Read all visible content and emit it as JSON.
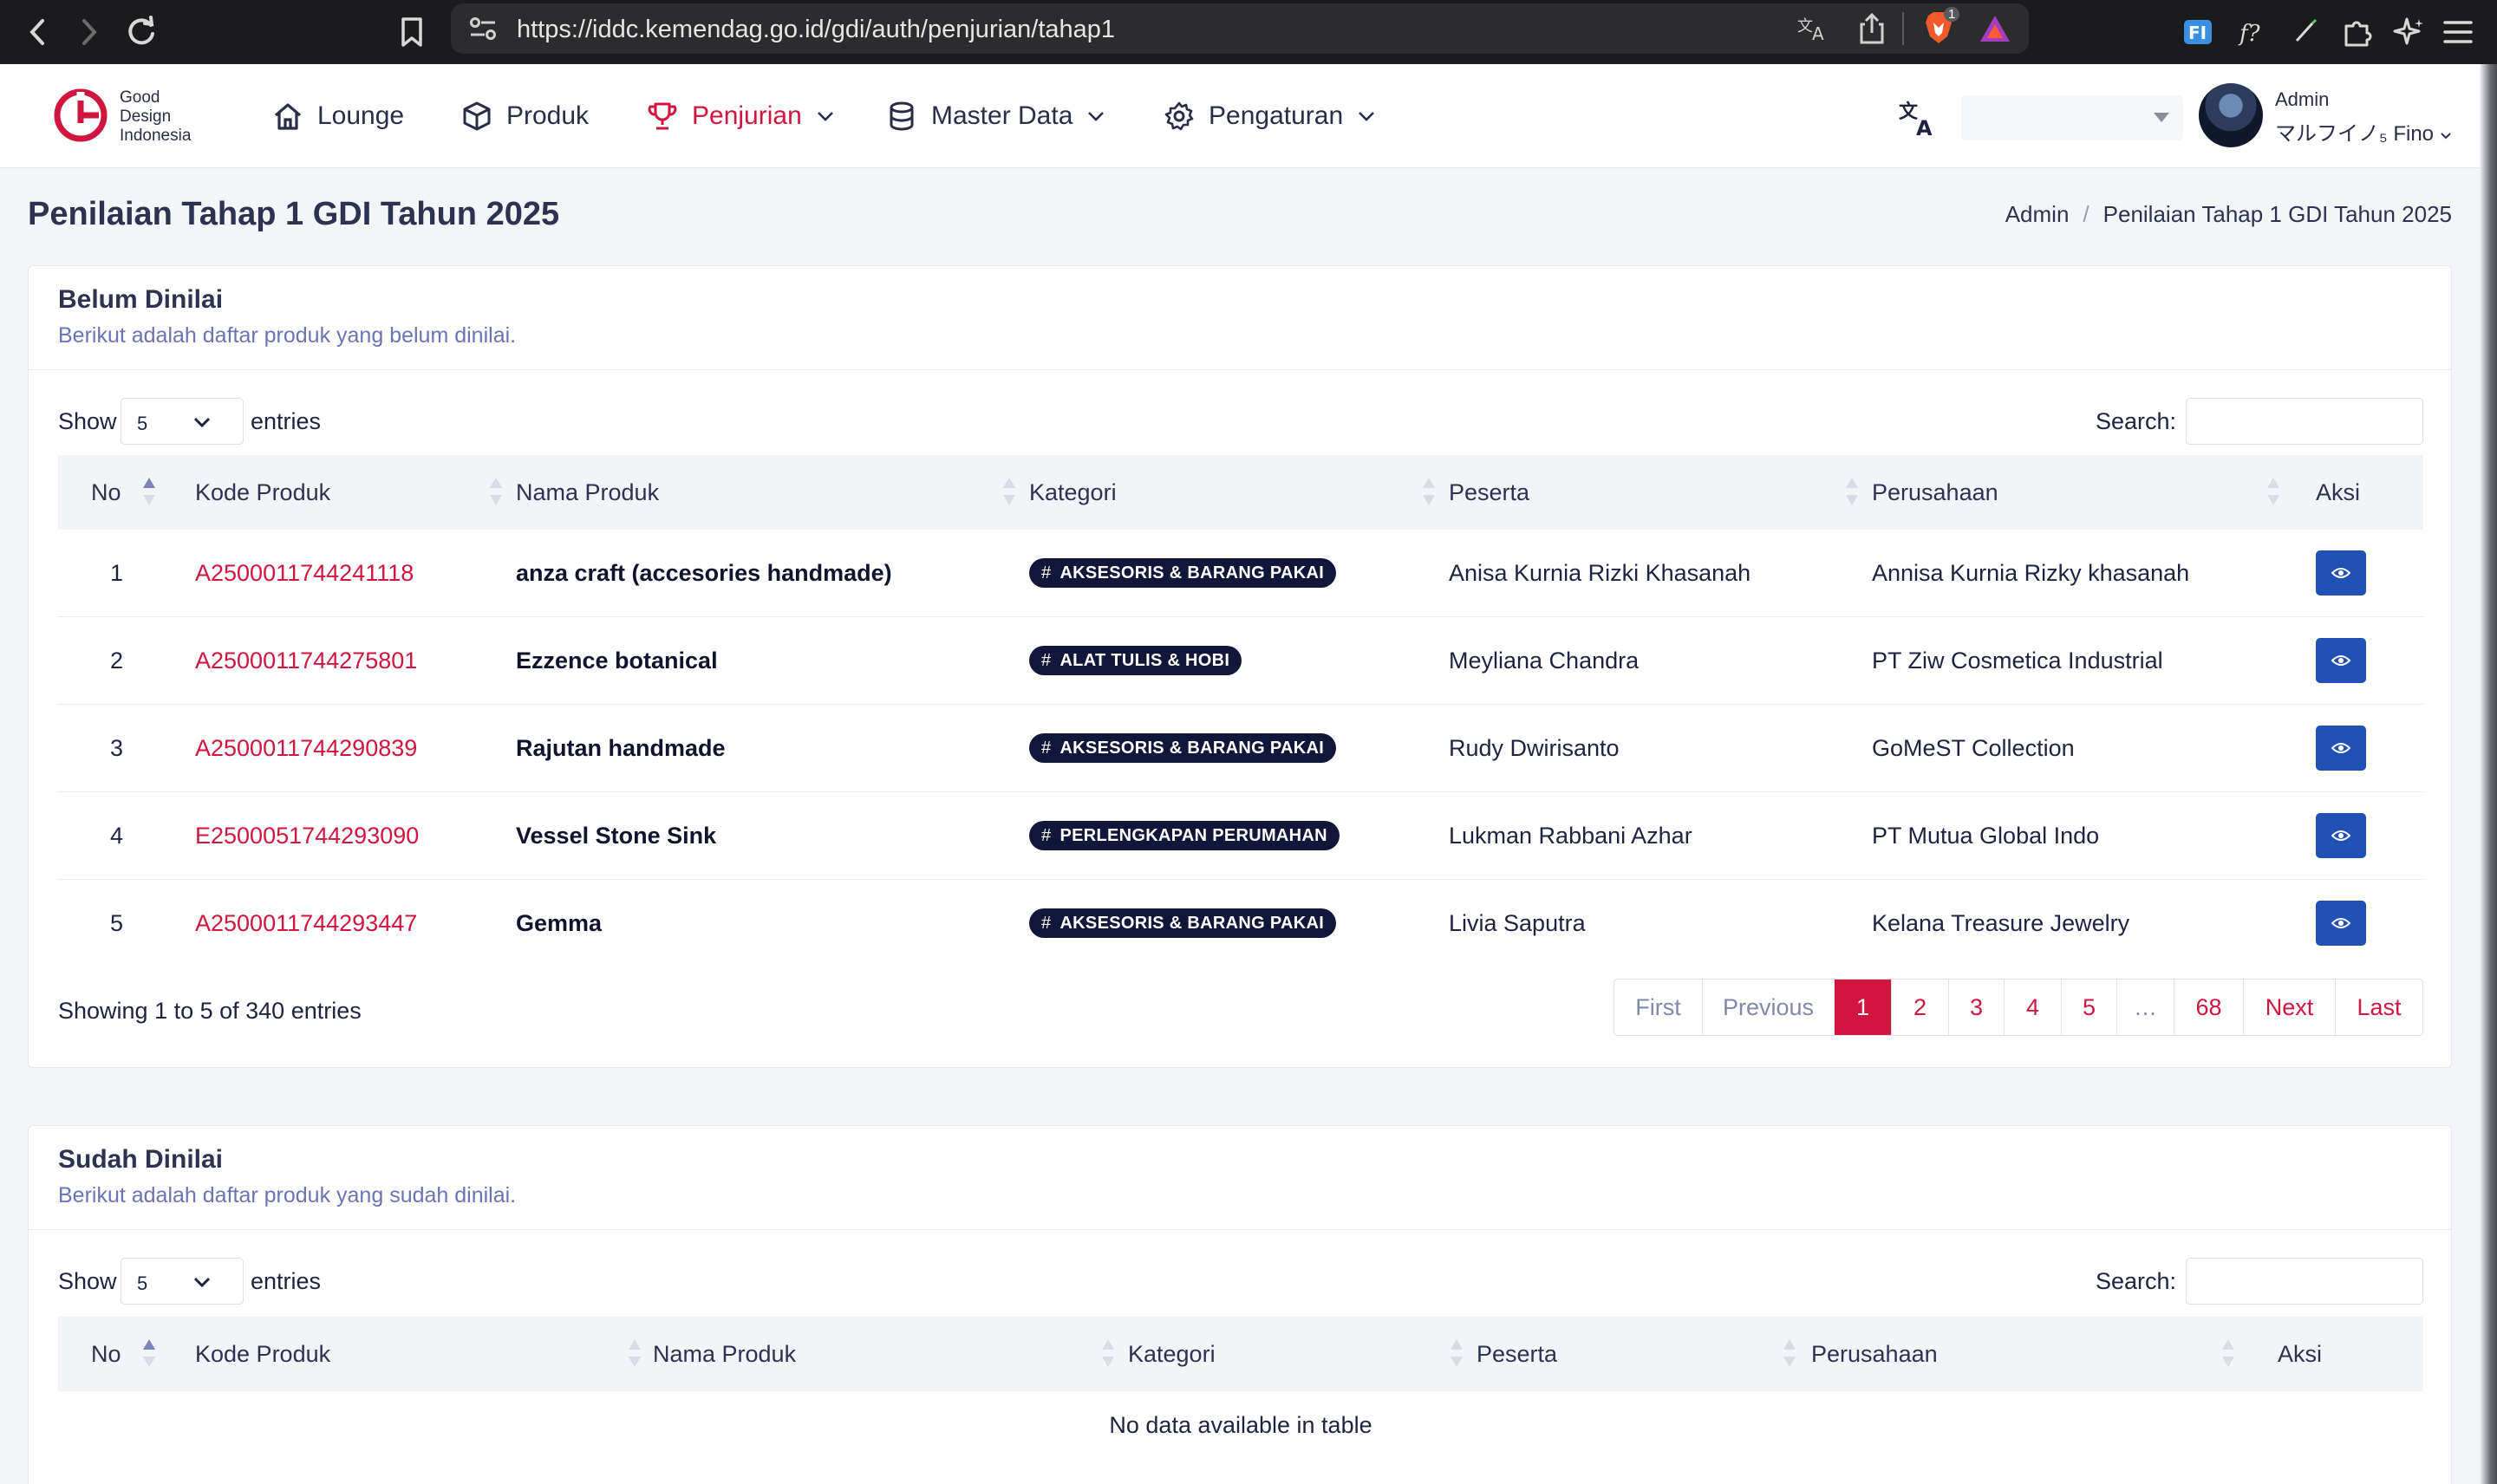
{
  "browser": {
    "url": "https://iddc.kemendag.go.id/gdi/auth/penjurian/tahap1",
    "shield_count": "1"
  },
  "app": {
    "logo": [
      "Good",
      "Design",
      "Indonesia"
    ],
    "menu": [
      {
        "label": "Lounge",
        "icon": "home-icon"
      },
      {
        "label": "Produk",
        "icon": "box-icon"
      },
      {
        "label": "Penjurian",
        "icon": "trophy-icon",
        "active": true
      },
      {
        "label": "Master Data",
        "icon": "database-icon"
      },
      {
        "label": "Pengaturan",
        "icon": "gear-icon"
      }
    ],
    "user": {
      "role": "Admin",
      "name": "マルフイノ₅ Fino"
    }
  },
  "page": {
    "title": "Penilaian Tahap 1 GDI Tahun 2025",
    "breadcrumb": [
      "Admin",
      "Penilaian Tahap 1 GDI Tahun 2025"
    ]
  },
  "colors": {
    "accent": "#d0153f",
    "action": "#2151b5",
    "badge": "#12163a"
  },
  "belum": {
    "title": "Belum Dinilai",
    "subtitle": "Berikut adalah daftar produk yang belum dinilai.",
    "show_label": "Show",
    "entries_value": "5",
    "entries_label": "entries",
    "search_label": "Search:",
    "columns": [
      "No",
      "Kode Produk",
      "Nama Produk",
      "Kategori",
      "Peserta",
      "Perusahaan",
      "Aksi"
    ],
    "rows": [
      {
        "no": "1",
        "code": "A2500011744241118",
        "name": "anza craft (accesories handmade)",
        "category": "AKSESORIS & BARANG PAKAI",
        "participant": "Anisa Kurnia Rizki Khasanah",
        "company": "Annisa Kurnia Rizky khasanah"
      },
      {
        "no": "2",
        "code": "A2500011744275801",
        "name": "Ezzence botanical",
        "category": "ALAT TULIS & HOBI",
        "participant": "Meyliana Chandra",
        "company": "PT Ziw Cosmetica Industrial"
      },
      {
        "no": "3",
        "code": "A2500011744290839",
        "name": "Rajutan handmade",
        "category": "AKSESORIS & BARANG PAKAI",
        "participant": "Rudy Dwirisanto",
        "company": "GoMeST Collection"
      },
      {
        "no": "4",
        "code": "E2500051744293090",
        "name": "Vessel Stone Sink",
        "category": "PERLENGKAPAN PERUMAHAN",
        "participant": "Lukman Rabbani Azhar",
        "company": "PT Mutua Global Indo"
      },
      {
        "no": "5",
        "code": "A2500011744293447",
        "name": "Gemma",
        "category": "AKSESORIS & BARANG PAKAI",
        "participant": "Livia Saputra",
        "company": "Kelana Treasure Jewelry"
      }
    ],
    "info": "Showing 1 to 5 of 340 entries",
    "pagination": [
      "First",
      "Previous",
      "1",
      "2",
      "3",
      "4",
      "5",
      "…",
      "68",
      "Next",
      "Last"
    ]
  },
  "sudah": {
    "title": "Sudah Dinilai",
    "subtitle": "Berikut adalah daftar produk yang sudah dinilai.",
    "show_label": "Show",
    "entries_value": "5",
    "entries_label": "entries",
    "search_label": "Search:",
    "columns": [
      "No",
      "Kode Produk",
      "Nama Produk",
      "Kategori",
      "Peserta",
      "Perusahaan",
      "Aksi"
    ],
    "empty": "No data available in table"
  }
}
